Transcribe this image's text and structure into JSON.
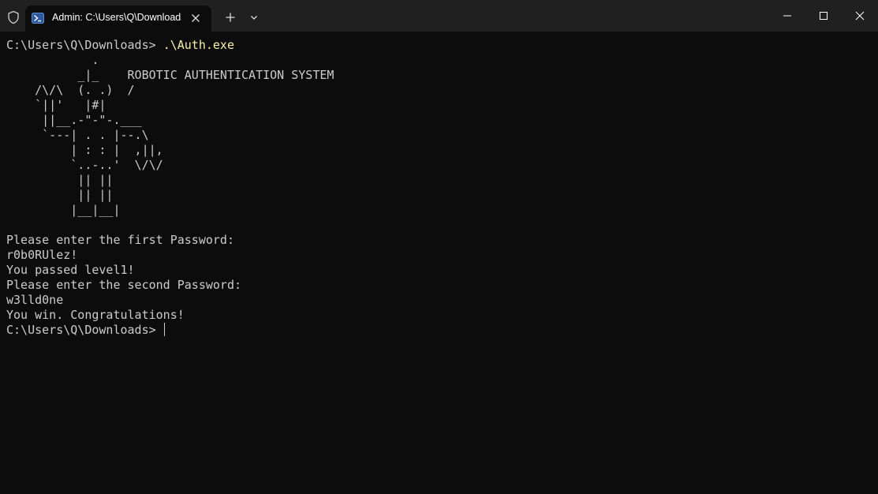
{
  "titlebar": {
    "tab_title": "Admin: C:\\Users\\Q\\Downloads",
    "icons": {
      "shield": "shield-icon",
      "tab": "powershell-icon",
      "tab_close": "close-icon",
      "new_tab": "plus-icon",
      "dropdown": "chevron-down-icon",
      "minimize": "minimize-icon",
      "maximize": "maximize-icon",
      "close": "close-window-icon"
    }
  },
  "terminal": {
    "prompt": "C:\\Users\\Q\\Downloads> ",
    "command": ".\\Auth.exe",
    "banner": [
      "            .",
      "          _|_    ROBOTIC AUTHENTICATION SYSTEM",
      "    /\\/\\  (. .)  /",
      "    `||'   |#|",
      "     ||__.-\"-\"-.___",
      "     `---| . . |--.\\",
      "         | : : |  ,||,",
      "         `..-..'  \\/\\/",
      "          || ||",
      "          || ||",
      "         |__|__|"
    ],
    "output": [
      "Please enter the first Password:",
      "r0b0RUlez!",
      "You passed level1!",
      "Please enter the second Password:",
      "w3lld0ne",
      "You win. Congratulations!"
    ],
    "final_prompt": "C:\\Users\\Q\\Downloads> "
  },
  "colors": {
    "background": "#0c0c0c",
    "titlebar": "#202020",
    "text": "#cccccc",
    "command": "#f9f1a5"
  }
}
